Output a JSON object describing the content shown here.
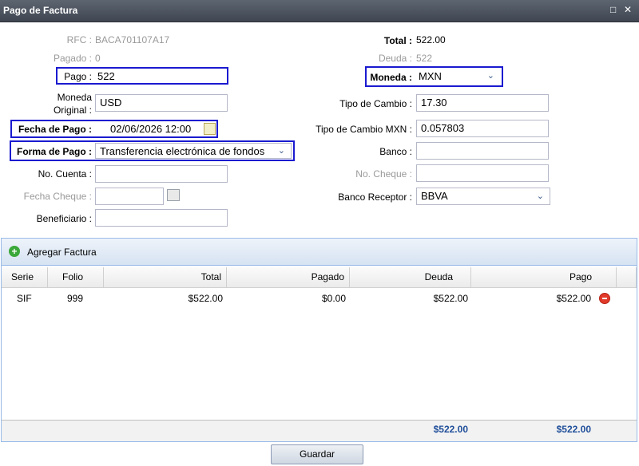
{
  "window": {
    "title": "Pago de Factura",
    "controls": [
      "□",
      "✕"
    ]
  },
  "form": {
    "rfc": {
      "label": "RFC :",
      "value": "BACA701107A17"
    },
    "pagado": {
      "label": "Pagado :",
      "value": "0"
    },
    "pago": {
      "label": "Pago :",
      "value": "522"
    },
    "moneda_original": {
      "label_line1": "Moneda",
      "label_line2": "Original :",
      "value": "USD"
    },
    "fecha_pago": {
      "label": "Fecha de Pago :",
      "value": "02/06/2026 12:00"
    },
    "forma_pago": {
      "label": "Forma de Pago :",
      "value": "Transferencia electrónica de fondos"
    },
    "no_cuenta": {
      "label": "No. Cuenta :",
      "value": ""
    },
    "fecha_cheque": {
      "label": "Fecha Cheque :",
      "value": ""
    },
    "beneficiario": {
      "label": "Beneficiario :",
      "value": ""
    },
    "total": {
      "label": "Total :",
      "value": "522.00"
    },
    "deuda": {
      "label": "Deuda :",
      "value": "522"
    },
    "moneda": {
      "label": "Moneda :",
      "value": "MXN"
    },
    "tipo_cambio": {
      "label": "Tipo de Cambio :",
      "value": "17.30"
    },
    "tipo_cambio_mxn": {
      "label": "Tipo de Cambio MXN :",
      "value": "0.057803"
    },
    "banco": {
      "label": "Banco :",
      "value": ""
    },
    "no_cheque": {
      "label": "No. Cheque :",
      "value": ""
    },
    "banco_receptor": {
      "label": "Banco Receptor :",
      "value": "BBVA"
    }
  },
  "grid": {
    "add_label": "Agregar Factura",
    "columns": [
      "Serie",
      "Folio",
      "Total",
      "Pagado",
      "Deuda",
      "Pago"
    ],
    "rows": [
      {
        "serie": "SIF",
        "folio": "999",
        "total": "$522.00",
        "pagado": "$0.00",
        "deuda": "$522.00",
        "pago": "$522.00"
      }
    ],
    "footer": {
      "deuda": "$522.00",
      "pago": "$522.00"
    }
  },
  "buttons": {
    "save": "Guardar"
  },
  "icons": {
    "add": "add-circle-icon",
    "remove": "remove-circle-icon",
    "calendar": "calendar-icon"
  }
}
